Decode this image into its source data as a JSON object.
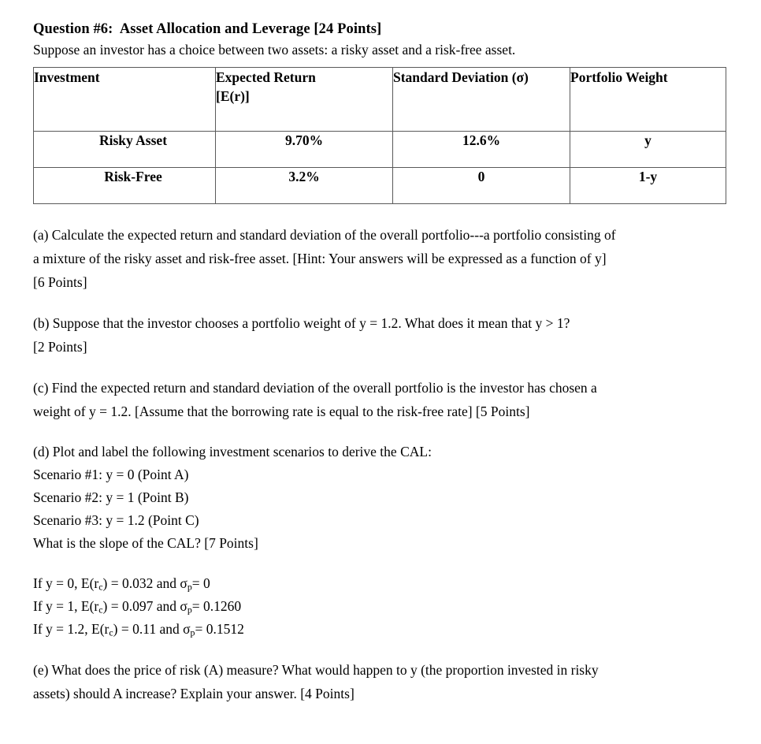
{
  "document": {
    "question_title": "Question #6:  Asset Allocation and Leverage [24 Points]",
    "intro": "Suppose an investor has a choice between two assets: a risky asset and a risk-free asset."
  },
  "table": {
    "headers": {
      "investment": "Investment",
      "expected_return_line1": "Expected Return",
      "expected_return_line2_pre": "[E(r",
      "expected_return_line2_sub": "",
      "expected_return_line2_post": ")]",
      "standard_deviation": "Standard Deviation (σ)",
      "portfolio_weight": "Portfolio Weight"
    },
    "rows": [
      {
        "investment": "Risky Asset",
        "expected_return": "9.70%",
        "standard_deviation": "12.6%",
        "portfolio_weight": "y"
      },
      {
        "investment": "Risk-Free",
        "expected_return": "3.2%",
        "standard_deviation": "0",
        "portfolio_weight": "1-y"
      }
    ]
  },
  "parts": {
    "a": {
      "line1": "(a)  Calculate the expected return and standard deviation of the overall portfolio---a portfolio consisting of",
      "line2": "a mixture of the risky asset and risk-free asset. [Hint:  Your answers will be expressed as a function of y]",
      "line3": "[6 Points]"
    },
    "b": {
      "line1": "(b)  Suppose that the investor chooses a portfolio weight of y = 1.2.  What does it mean that y > 1?",
      "line2": "[2 Points]"
    },
    "c": {
      "line1": " (c)  Find the expected return and standard deviation of the overall portfolio is the investor has chosen a",
      "line2": "weight of y = 1.2.  [Assume that the borrowing rate is equal to the risk-free rate] [5 Points]"
    },
    "d": {
      "line1": "(d)  Plot and label the following investment scenarios to derive the CAL:",
      "scenarios": [
        "Scenario #1: y = 0 (Point A)",
        "Scenario #2: y = 1 (Point B)",
        "Scenario #3: y = 1.2  (Point C)"
      ],
      "slope_question": "What is the slope of the CAL? [7 Points]"
    },
    "equations": [
      {
        "prefix": "If y = 0, E(r",
        "sub1": "c",
        "mid": ") = 0.032 and σ",
        "sub2": "p",
        "suffix": "= 0"
      },
      {
        "prefix": "If y = 1, E(r",
        "sub1": "c",
        "mid": ") = 0.097 and σ",
        "sub2": "p",
        "suffix": "= 0.1260"
      },
      {
        "prefix": "If y = 1.2, E(r",
        "sub1": "c",
        "mid": ") = 0.11 and σ",
        "sub2": "p",
        "suffix": "= 0.1512"
      }
    ],
    "e": {
      "line1": " (e)  What does the price of risk (A) measure?  What would happen to y (the proportion invested in risky",
      "line2": "assets) should A increase?  Explain your answer. [4 Points]"
    }
  },
  "colors": {
    "text": "#000000",
    "table_border": "#5a5a5a",
    "page_background": "#ffffff"
  }
}
